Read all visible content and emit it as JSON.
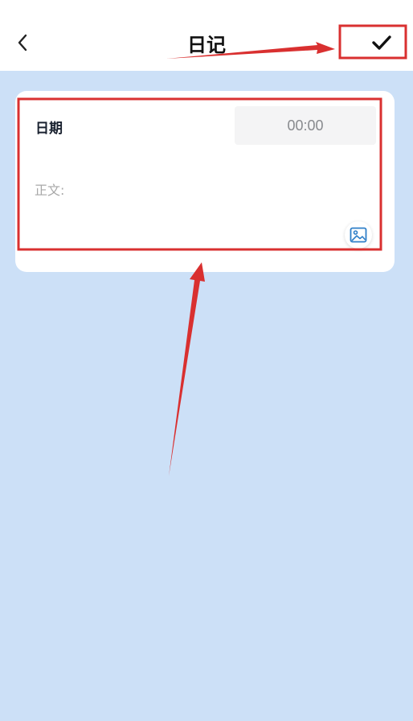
{
  "header": {
    "title": "日记",
    "back_icon": "chevron-left-icon",
    "confirm_icon": "checkmark-icon"
  },
  "entry": {
    "date_label": "日期",
    "time_value": "00:00",
    "body_placeholder": "正文:",
    "image_icon": "image-icon"
  },
  "colors": {
    "background": "#cce0f7",
    "highlight": "#d93030",
    "icon_blue": "#2f7fc8"
  }
}
